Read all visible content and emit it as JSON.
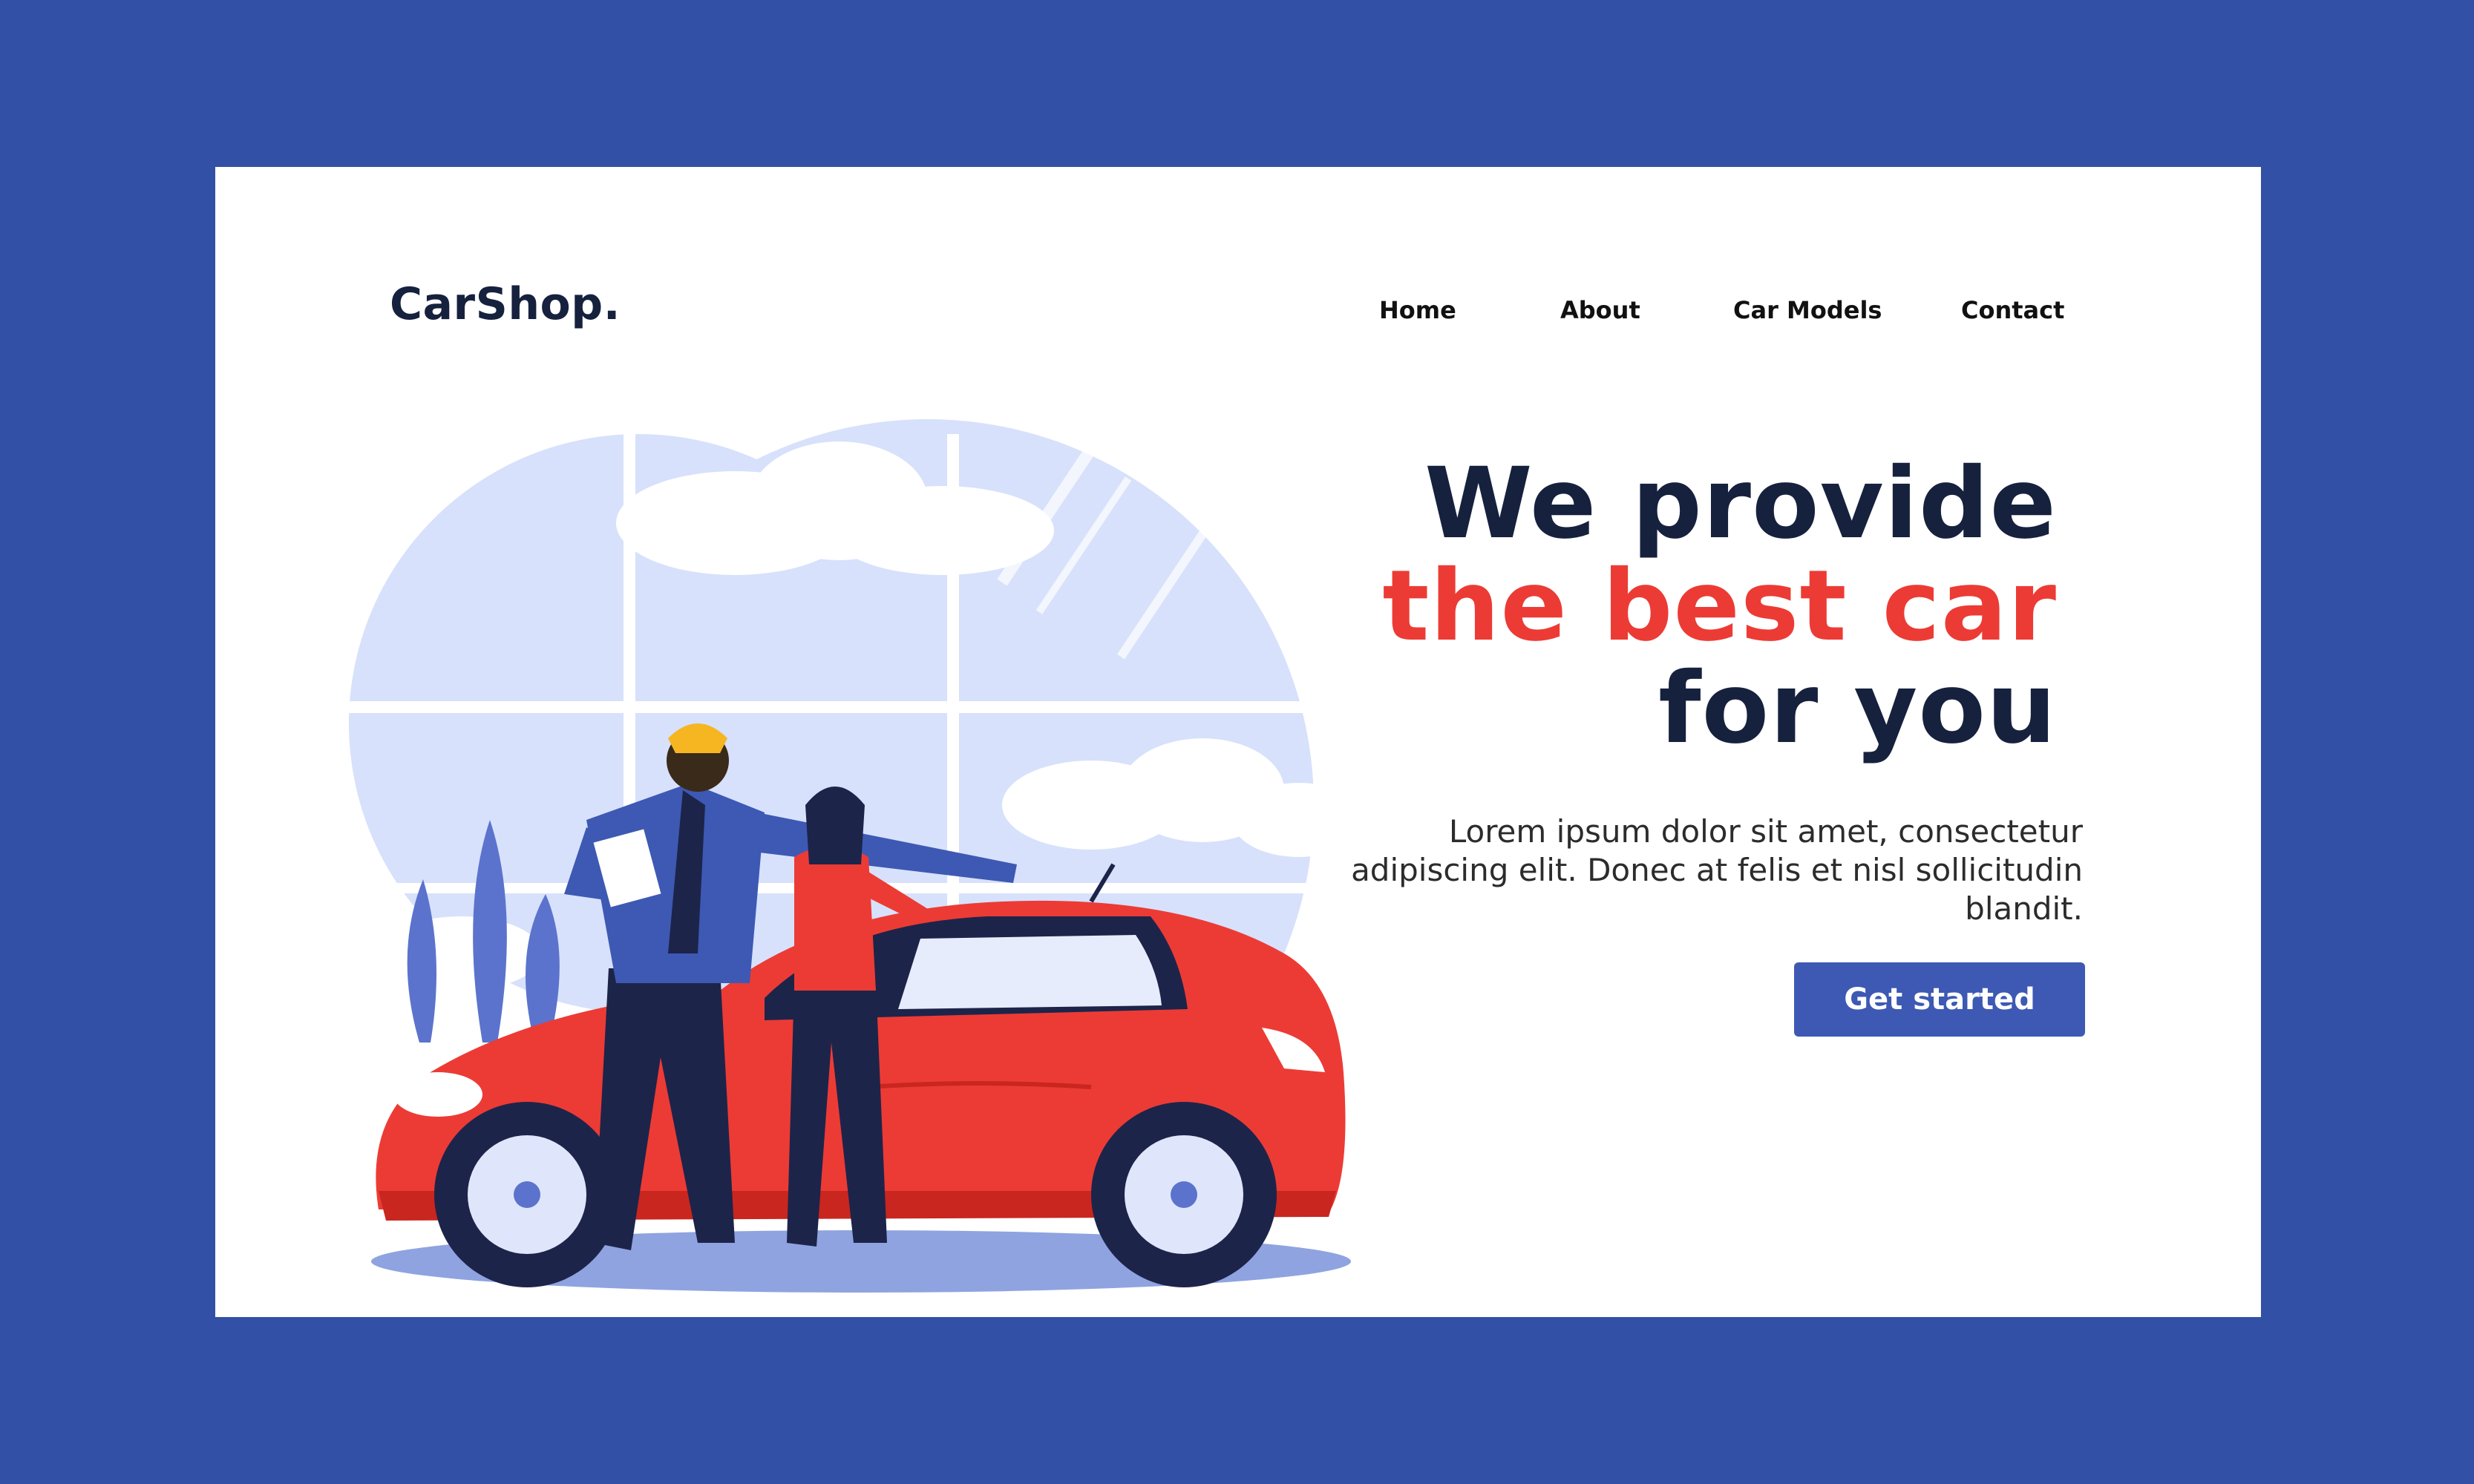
{
  "brand": {
    "logo": "CarShop."
  },
  "nav": {
    "items": [
      {
        "label": "Home"
      },
      {
        "label": "About"
      },
      {
        "label": "Car Models"
      },
      {
        "label": "Contact"
      }
    ]
  },
  "hero": {
    "headline_line1": "We provide",
    "headline_line2": "the best car",
    "headline_line3": "for you",
    "body": "Lorem ipsum dolor sit amet, consectetur adipiscing elit. Donec at felis et nisl sollicitudin blandit.",
    "cta_label": "Get started"
  },
  "colors": {
    "frame_background": "#3250a5",
    "card_background": "#ffffff",
    "headline_dark": "#16213e",
    "headline_accent": "#ec3b35",
    "button": "#3d59b3"
  },
  "icons": {
    "illustration": "car-dealer-illustration"
  }
}
